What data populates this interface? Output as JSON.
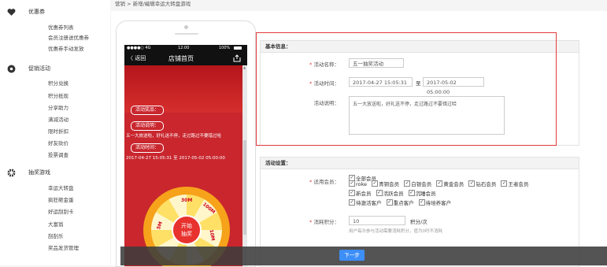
{
  "breadcrumb": "营销 > 新增/编辑幸运大转盘游戏",
  "sidebar": {
    "sections": [
      {
        "title": "优惠券",
        "items": [
          "优惠券列表",
          "会员注册送优惠券",
          "优惠券手动发放"
        ]
      },
      {
        "title": "促销活动",
        "items": [
          "积分兑换",
          "积分抵现",
          "分享助力",
          "满减活动",
          "限时折扣",
          "好友砍价",
          "投票调查"
        ]
      },
      {
        "title": "抽奖游戏",
        "items": [
          "幸运大转盘",
          "疯狂砸金蛋",
          "好运刮刮卡",
          "大富翁",
          "刮刮乐",
          "奖品发货管理"
        ]
      }
    ]
  },
  "phone": {
    "status_left": "●●●●○ 4G",
    "status_time": "12:00",
    "status_right": "100%",
    "back_label": "〈 返回",
    "title": "店铺首页",
    "tag_prize": "活动奖品：",
    "tag_desc": "活动说明：",
    "desc_text": "五一大放送啦，好礼送不停，走过路过不要错过哈",
    "tag_time": "活动时间：",
    "time_text": "2017-04-27 15:05:31 至 2017-05-02 05:00:00",
    "wheel_center": [
      "开始",
      "抽奖"
    ],
    "wheel_prizes": [
      "30M",
      "100M",
      "5M",
      "10M"
    ]
  },
  "basic": {
    "title": "基本信息：",
    "name_label": "活动名称：",
    "name_value": "五一抽奖活动",
    "time_label": "活动时间：",
    "time_start": "2017-04-27 15:05:31",
    "time_sep": "至",
    "time_end": "2017-05-02 05:00:00",
    "desc_label": "活动说明：",
    "desc_value": "五一大放送啦，好礼送不停，走过路过不要错过哈"
  },
  "settings": {
    "title": "活动设置：",
    "member_label": "适用会员：",
    "members_row1": [
      "全部会员"
    ],
    "members_row2": [
      "roke",
      "青铜会员",
      "白银会员",
      "黄金会员",
      "钻石会员",
      "王者会员"
    ],
    "members_row3": [
      "新会员",
      "活跃会员",
      "沉睡会员"
    ],
    "members_row4": [
      "待激活客户",
      "重点客户",
      "待培养客户"
    ],
    "points_label": "消耗积分：",
    "points_value": "10",
    "points_unit": "积分/次",
    "points_hint": "用户每次参与活动需要消耗积分，值为0时不消耗"
  },
  "footer": {
    "next_label": "下一步"
  },
  "colors": {
    "accent": "#3e8ef7",
    "highlight": "#e4393c",
    "phone_red": "#c9262e"
  }
}
